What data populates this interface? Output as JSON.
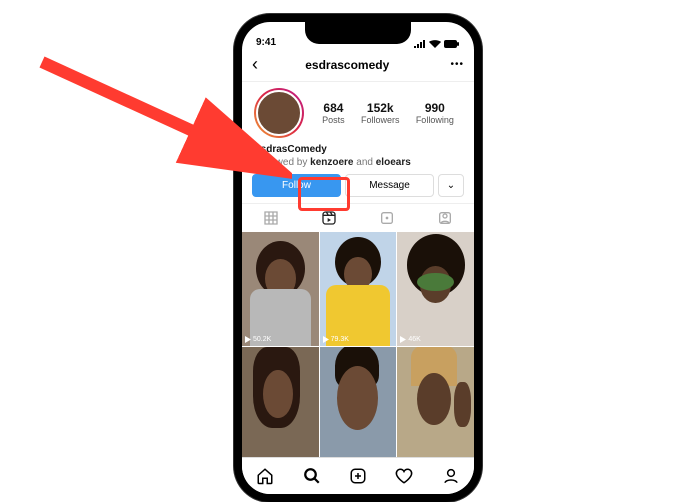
{
  "status": {
    "time": "9:41"
  },
  "header": {
    "username": "esdrascomedy"
  },
  "stats": {
    "posts": {
      "n": "684",
      "l": "Posts"
    },
    "followers": {
      "n": "152k",
      "l": "Followers"
    },
    "following": {
      "n": "990",
      "l": "Following"
    }
  },
  "bio": {
    "name": "EsdrasComedy",
    "followed_by_prefix": "Followed by ",
    "f1": "kenzoere",
    "and": " and ",
    "f2": "eloears"
  },
  "buttons": {
    "follow": "Follow",
    "message": "Message",
    "chevron": "⌄"
  },
  "reels": [
    {
      "views": "50.2K"
    },
    {
      "views": "79.3K"
    },
    {
      "views": "46K"
    },
    {
      "views": ""
    },
    {
      "views": ""
    },
    {
      "views": ""
    }
  ]
}
